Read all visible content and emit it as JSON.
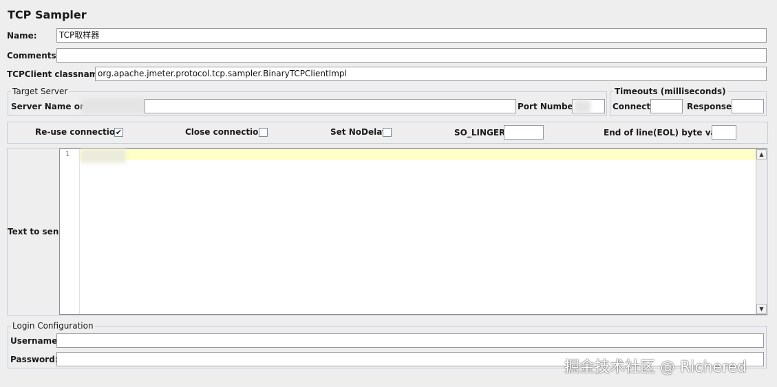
{
  "title": "TCP Sampler",
  "name": {
    "label": "Name:",
    "value": "TCP取样器"
  },
  "comments": {
    "label": "Comments:",
    "value": ""
  },
  "classname": {
    "label": "TCPClient classname:",
    "value": "org.apache.jmeter.protocol.tcp.sampler.BinaryTCPClientImpl"
  },
  "target_server": {
    "legend": "Target Server",
    "server_label": "Server Name or IP:",
    "server_value": "",
    "port_label": "Port Number:",
    "port_value": ""
  },
  "timeouts": {
    "legend": "Timeouts (milliseconds)",
    "connect_label": "Connect:",
    "connect_value": "",
    "response_label": "Response:",
    "response_value": ""
  },
  "options": {
    "reuse_label": "Re-use connection",
    "reuse_checked": true,
    "reuse_mark": "✔",
    "close_label": "Close connection",
    "close_checked": false,
    "nodelay_label": "Set NoDelay",
    "nodelay_checked": false,
    "solinger_label": "SO_LINGER:",
    "solinger_value": "",
    "eol_label": "End of line(EOL) byte value:",
    "eol_value": ""
  },
  "text_to_send": {
    "label": "Text to send",
    "line_number": "1",
    "scroll_up": "▲",
    "scroll_down": "▼"
  },
  "login": {
    "legend": "Login Configuration",
    "username_label": "Username:",
    "username_value": "",
    "password_label": "Password:",
    "password_value": ""
  },
  "watermark": "掘金技术社区 @ Richered",
  "colors": {
    "current_line": "#ffffc8",
    "border": "#c6ccd6"
  }
}
